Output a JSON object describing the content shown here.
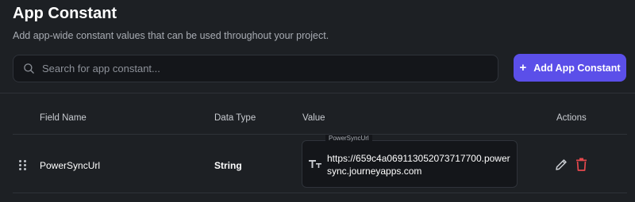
{
  "header": {
    "title": "App Constant",
    "subtitle": "Add app-wide constant values that can be used throughout your project."
  },
  "search": {
    "placeholder": "Search for app constant...",
    "value": ""
  },
  "add_button": {
    "icon": "+",
    "label": "Add App Constant"
  },
  "table": {
    "columns": {
      "field_name": "Field Name",
      "data_type": "Data Type",
      "value": "Value",
      "actions": "Actions"
    },
    "rows": [
      {
        "field_name": "PowerSyncUrl",
        "data_type": "String",
        "value_label": "PowerSyncUrl",
        "value": "https://659c4a069113052073717700.powersync.journeyapps.com",
        "actions": [
          "edit-icon",
          "delete-icon"
        ]
      }
    ]
  },
  "colors": {
    "background": "#1d2024",
    "accent": "#5b4fe9",
    "delete": "#e5484d",
    "field_bg": "#14161a"
  }
}
